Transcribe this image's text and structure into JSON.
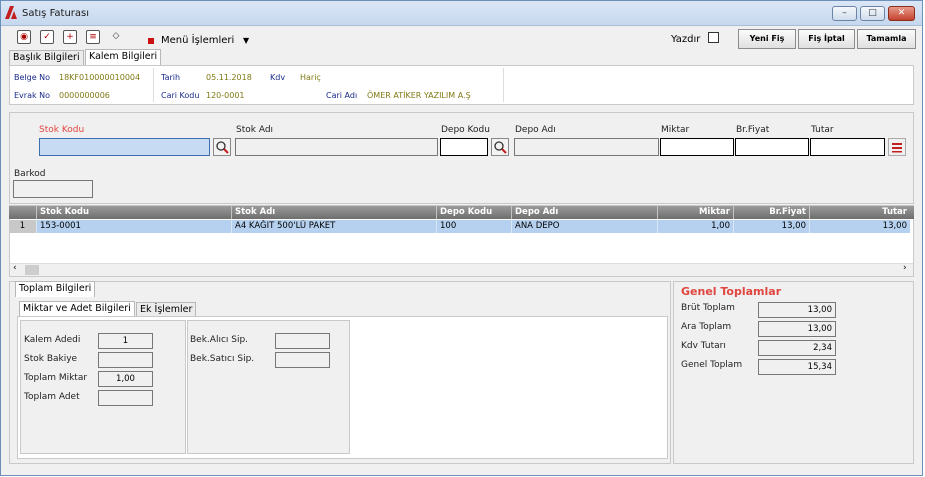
{
  "window": {
    "title": "Satış Faturası",
    "minimize": "–",
    "maximize": "□",
    "close": "✕"
  },
  "toolbar": {
    "menu_label": "Menü İşlemleri",
    "print_label": "Yazdır",
    "print_checked": false,
    "buttons": {
      "new_receipt": "Yeni Fiş",
      "cancel_receipt": "Fiş İptal",
      "complete": "Tamamla"
    }
  },
  "tabs": [
    {
      "label": "Başlık Bilgileri",
      "active": false
    },
    {
      "label": "Kalem Bilgileri",
      "active": true
    }
  ],
  "header": {
    "belge_no_label": "Belge No",
    "belge_no": "18KF010000010004",
    "tarih_label": "Tarih",
    "tarih": "05.11.2018",
    "kdv_label": "Kdv",
    "kdv": "Hariç",
    "evrak_no_label": "Evrak No",
    "evrak_no": "0000000006",
    "cari_kodu_label": "Cari Kodu",
    "cari_kodu": "120-0001",
    "cari_adi_label": "Cari Adı",
    "cari_adi": "ÖMER ATİKER YAZILIM A.Ş"
  },
  "entry": {
    "stok_kodu_label": "Stok Kodu",
    "stok_adi_label": "Stok Adı",
    "depo_kodu_label": "Depo Kodu",
    "depo_adi_label": "Depo Adı",
    "miktar_label": "Miktar",
    "br_fiyat_label": "Br.Fiyat",
    "tutar_label": "Tutar",
    "barkod_label": "Barkod",
    "stok_kodu_value": "",
    "stok_adi_value": "",
    "depo_kodu_value": "",
    "depo_adi_value": "",
    "miktar_value": "",
    "br_fiyat_value": "",
    "tutar_value": "",
    "barkod_value": ""
  },
  "grid": {
    "columns": [
      "Stok Kodu",
      "Stok Adı",
      "Depo Kodu",
      "Depo Adı",
      "Miktar",
      "Br.Fiyat",
      "Tutar"
    ],
    "rows": [
      {
        "no": "1",
        "stok_kodu": "153-0001",
        "stok_adi": "A4 KAĞIT 500'LÜ PAKET",
        "depo_kodu": "100",
        "depo_adi": "ANA DEPO",
        "miktar": "1,00",
        "br_fiyat": "13,00",
        "tutar": "13,00"
      }
    ]
  },
  "totals_tab": {
    "label": "Toplam Bilgileri",
    "subtabs": [
      {
        "label": "Miktar ve Adet Bilgileri",
        "active": true
      },
      {
        "label": "Ek İşlemler",
        "active": false
      }
    ],
    "kalem_adedi_label": "Kalem Adedi",
    "kalem_adedi": "1",
    "stok_bakiye_label": "Stok Bakiye",
    "stok_bakiye": "",
    "toplam_miktar_label": "Toplam Miktar",
    "toplam_miktar": "1,00",
    "toplam_adet_label": "Toplam Adet",
    "toplam_adet": "",
    "bek_alici_label": "Bek.Alıcı Sip.",
    "bek_alici": "",
    "bek_satici_label": "Bek.Satıcı Sip.",
    "bek_satici": ""
  },
  "genel": {
    "title": "Genel Toplamlar",
    "brut_label": "Brüt Toplam",
    "brut": "13,00",
    "ara_label": "Ara Toplam",
    "ara": "13,00",
    "kdv_label": "Kdv Tutarı",
    "kdv": "2,34",
    "genel_label": "Genel Toplam",
    "genel": "15,34"
  },
  "colors": {
    "accent_red": "#e0463f",
    "header_label": "#1a2a8a",
    "header_value": "#7f7a14",
    "row_selected": "#b5d1ef"
  }
}
